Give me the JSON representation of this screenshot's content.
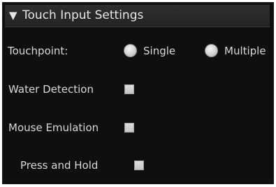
{
  "header": {
    "arrow_glyph": "▼",
    "title": "Touch Input Settings"
  },
  "touchpoint": {
    "label": "Touchpoint:",
    "options": [
      {
        "label": "Single",
        "selected": false
      },
      {
        "label": "Multiple",
        "selected": false
      }
    ]
  },
  "water_detection": {
    "label": "Water Detection",
    "checked": false
  },
  "mouse_emulation": {
    "label": "Mouse Emulation",
    "checked": false
  },
  "press_and_hold": {
    "label": "Press and Hold",
    "checked": false
  },
  "colors": {
    "panel_bg": "#0f0f0f",
    "header_bg": "#2a2a2a",
    "text": "#d8d8d8"
  }
}
